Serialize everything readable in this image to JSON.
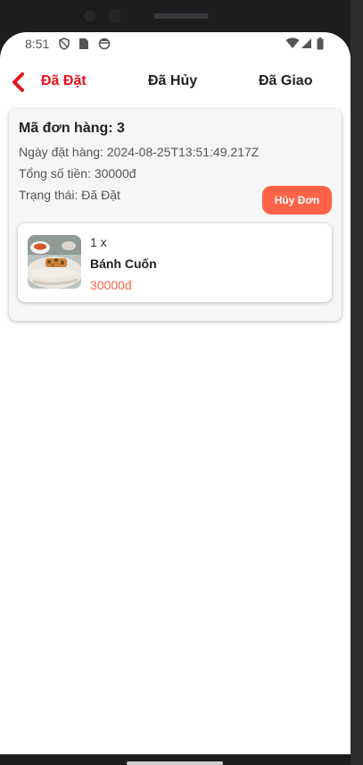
{
  "status_bar": {
    "time": "8:51",
    "icons_left": [
      "shield-icon",
      "sim-card-icon",
      "circle-status-icon"
    ],
    "icons_right": [
      "wifi-icon",
      "signal-icon",
      "battery-icon"
    ]
  },
  "tabs": [
    {
      "label": "Đã Đặt",
      "active": true
    },
    {
      "label": "Đã Hủy",
      "active": false
    },
    {
      "label": "Đã Giao",
      "active": false
    }
  ],
  "order": {
    "title": "Mã đơn hàng: 3",
    "date_line": "Ngày đặt hàng: 2024-08-25T13:51:49.217Z",
    "total_line": "Tổng số tiền: 30000đ",
    "status_line": "Trạng thái: Đã Đặt",
    "cancel_label": "Hủy Đơn",
    "items": [
      {
        "quantity": "1 x",
        "name": "Bánh Cuốn",
        "price": "30000đ",
        "image": "banh-cuon-photo"
      }
    ]
  },
  "colors": {
    "accent_red": "#e8141b",
    "button_orange": "#ff6347",
    "card_bg": "#f6f6f6"
  }
}
